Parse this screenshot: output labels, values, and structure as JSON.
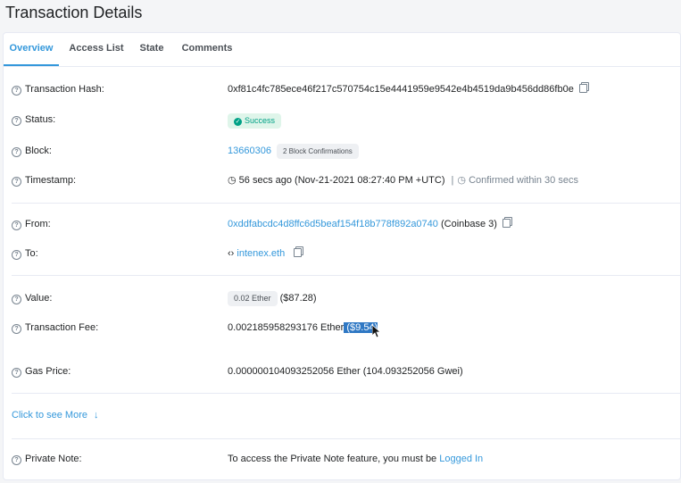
{
  "page_title": "Transaction Details",
  "tabs": [
    {
      "label": "Overview"
    },
    {
      "label": "Access List"
    },
    {
      "label": "State"
    },
    {
      "label": "Comments"
    }
  ],
  "rows": {
    "tx_hash": {
      "label": "Transaction Hash:",
      "value": "0xf81c4fc785ece46f217c570754c15e4441959e9542e4b4519da9b456dd86fb0e"
    },
    "status": {
      "label": "Status:",
      "value": "Success"
    },
    "block": {
      "label": "Block:",
      "value": "13660306",
      "confirmations": "2 Block Confirmations"
    },
    "timestamp": {
      "label": "Timestamp:",
      "value": "56 secs ago (Nov-21-2021 08:27:40 PM +UTC)",
      "separator": "|",
      "confirmed": "Confirmed within 30 secs"
    },
    "from": {
      "label": "From:",
      "value": "0xddfabcdc4d8ffc6d5beaf154f18b778f892a0740",
      "tag": "(Coinbase 3)"
    },
    "to": {
      "label": "To:",
      "value": "intenex.eth"
    },
    "value": {
      "label": "Value:",
      "amount": "0.02 Ether",
      "usd": "($87.28)"
    },
    "fee": {
      "label": "Transaction Fee:",
      "amount": "0.002185958293176 Ether",
      "usd": "($9.54)"
    },
    "gas": {
      "label": "Gas Price:",
      "value": "0.000000104093252056 Ether (104.093252056 Gwei)"
    },
    "more": {
      "label": "Click to see More",
      "arrow": "↓"
    },
    "note": {
      "label": "Private Note:",
      "text": "To access the Private Note feature, you must be ",
      "link": "Logged In"
    }
  },
  "icons": {
    "question": "?",
    "check": "✓",
    "clock": "◷",
    "code": "‹›"
  },
  "colors": {
    "link": "#3498db",
    "success": "#00a186",
    "highlight": "#2f78c4"
  }
}
